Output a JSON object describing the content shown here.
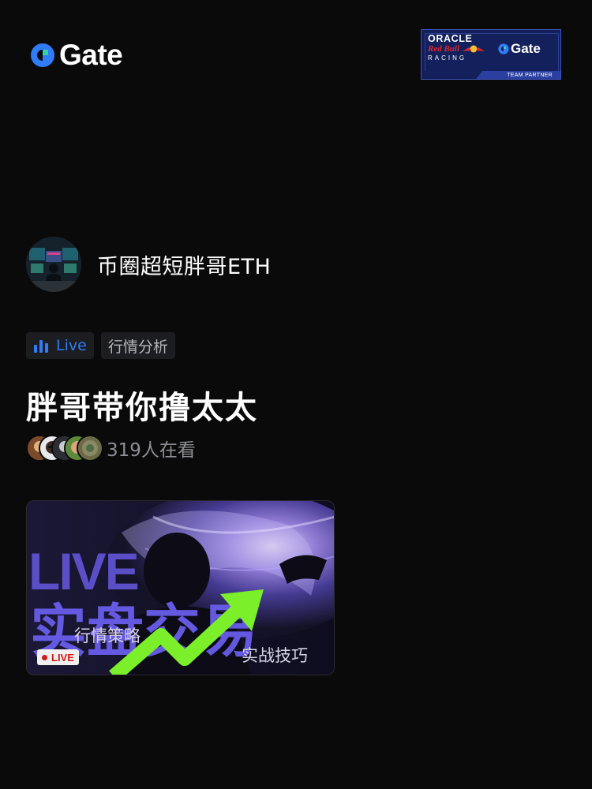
{
  "brand": {
    "name": "Gate",
    "accent": "#2f7cf6",
    "mark_icon": "gate-logo-mark"
  },
  "partner_badge": {
    "line1": "ORACLE",
    "line2": "Red Bull",
    "line3": "RACING",
    "brand": "Gate",
    "footer": "TEAM PARTNER"
  },
  "stream": {
    "streamer_name": "币圈超短胖哥ETH",
    "live_label": "Live",
    "category": "行情分析",
    "title": "胖哥带你撸太太",
    "viewer_count_text": "319人在看"
  },
  "cover": {
    "big_text_1": "LIVE",
    "big_text_2": "实盘交易",
    "sub_1": "行情策略",
    "sub_2": "实战技巧",
    "pill": "LIVE"
  },
  "colors": {
    "background": "#0a0a0b",
    "live_blue": "#2f7cf6",
    "tag_bg": "#1c1d20",
    "muted_text": "#8e8f94",
    "cover_purple": "#5a4ec0",
    "arrow_green": "#7bf02a",
    "live_red": "#d11b1b"
  }
}
